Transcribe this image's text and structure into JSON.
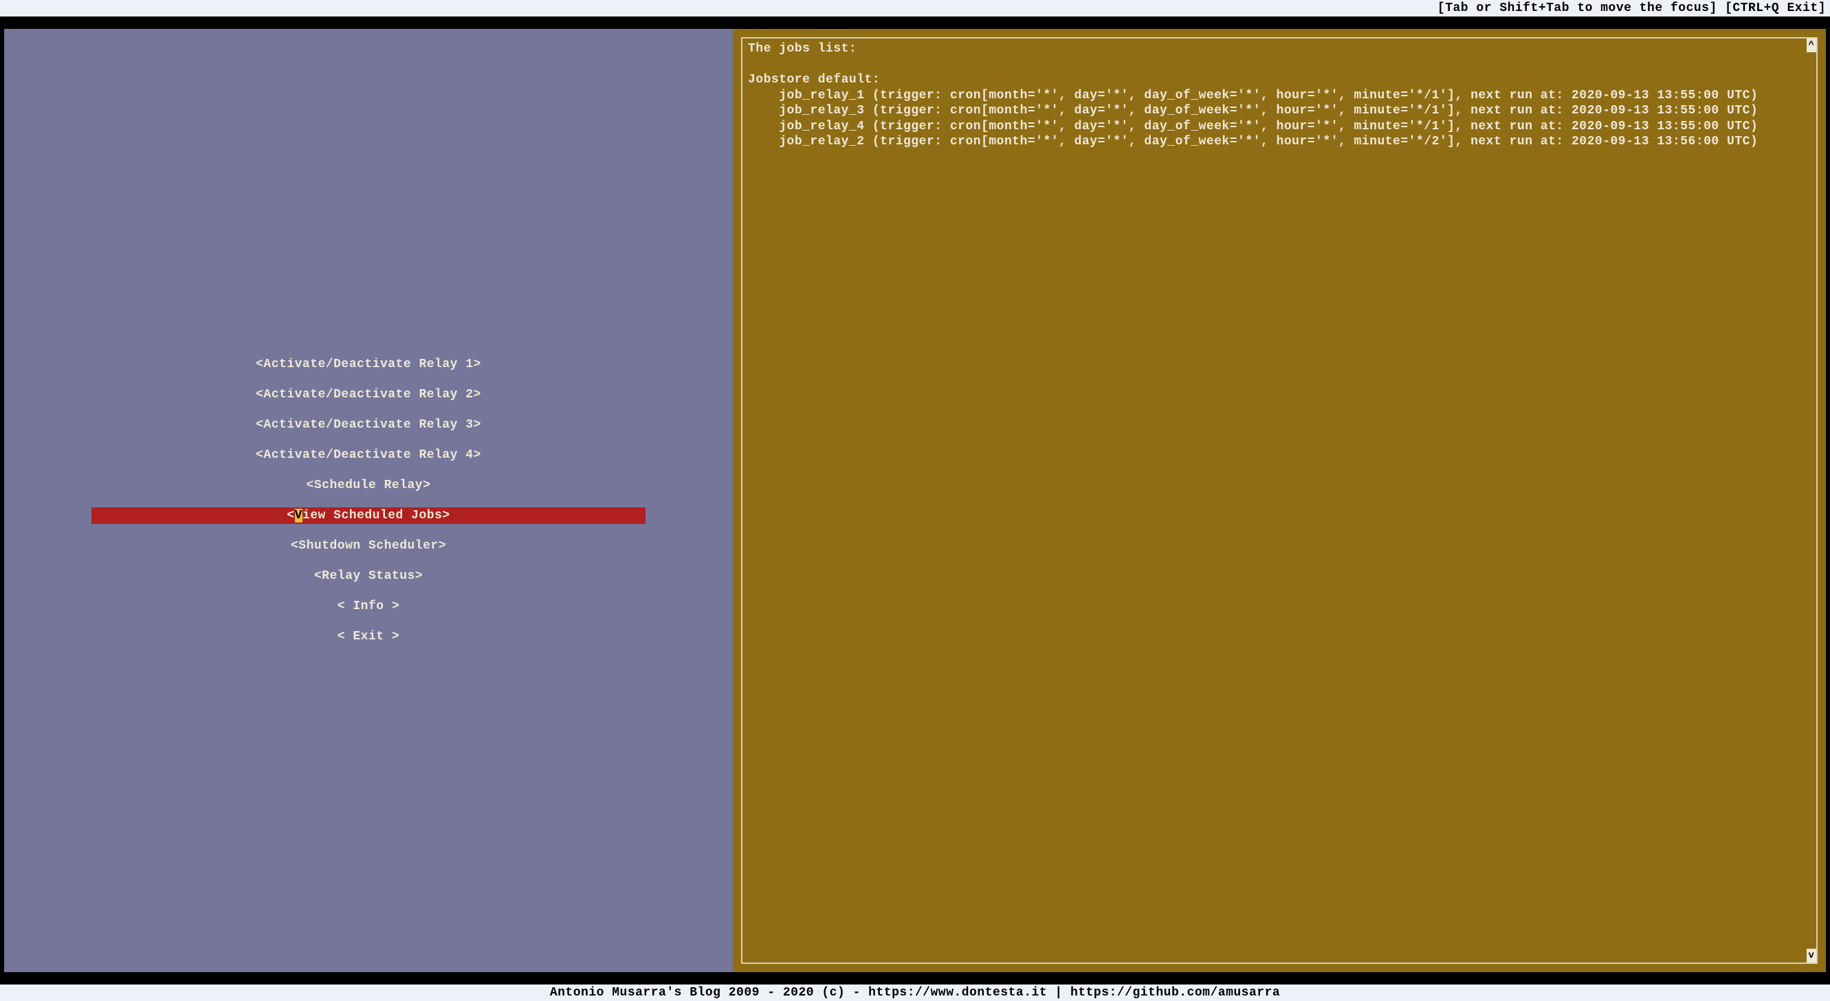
{
  "topbar": {
    "hint": "[Tab or Shift+Tab to move the focus] [CTRL+Q Exit]"
  },
  "menu": {
    "items": [
      {
        "label": "<Activate/Deactivate Relay 1>",
        "selected": false
      },
      {
        "label": "<Activate/Deactivate Relay 2>",
        "selected": false
      },
      {
        "label": "<Activate/Deactivate Relay 3>",
        "selected": false
      },
      {
        "label": "<Activate/Deactivate Relay 4>",
        "selected": false
      },
      {
        "label": "<Schedule Relay>",
        "selected": false
      },
      {
        "label": "<View Scheduled Jobs>",
        "selected": true
      },
      {
        "label": "<Shutdown Scheduler>",
        "selected": false
      },
      {
        "label": "<Relay Status>",
        "selected": false
      },
      {
        "label": "<   Info   >",
        "selected": false
      },
      {
        "label": "<   Exit   >",
        "selected": false
      }
    ]
  },
  "output": {
    "header": "The jobs list:",
    "jobstore_label": "Jobstore default:",
    "jobs": [
      "    job_relay_1 (trigger: cron[month='*', day='*', day_of_week='*', hour='*', minute='*/1'], next run at: 2020-09-13 13:55:00 UTC)",
      "    job_relay_3 (trigger: cron[month='*', day='*', day_of_week='*', hour='*', minute='*/1'], next run at: 2020-09-13 13:55:00 UTC)",
      "    job_relay_4 (trigger: cron[month='*', day='*', day_of_week='*', hour='*', minute='*/1'], next run at: 2020-09-13 13:55:00 UTC)",
      "    job_relay_2 (trigger: cron[month='*', day='*', day_of_week='*', hour='*', minute='*/2'], next run at: 2020-09-13 13:56:00 UTC)"
    ]
  },
  "footer": {
    "text": "Antonio Musarra's Blog 2009 - 2020 (c) - https://www.dontesta.it | https://github.com/amusarra"
  },
  "scroll": {
    "up": "^",
    "down": "v"
  }
}
